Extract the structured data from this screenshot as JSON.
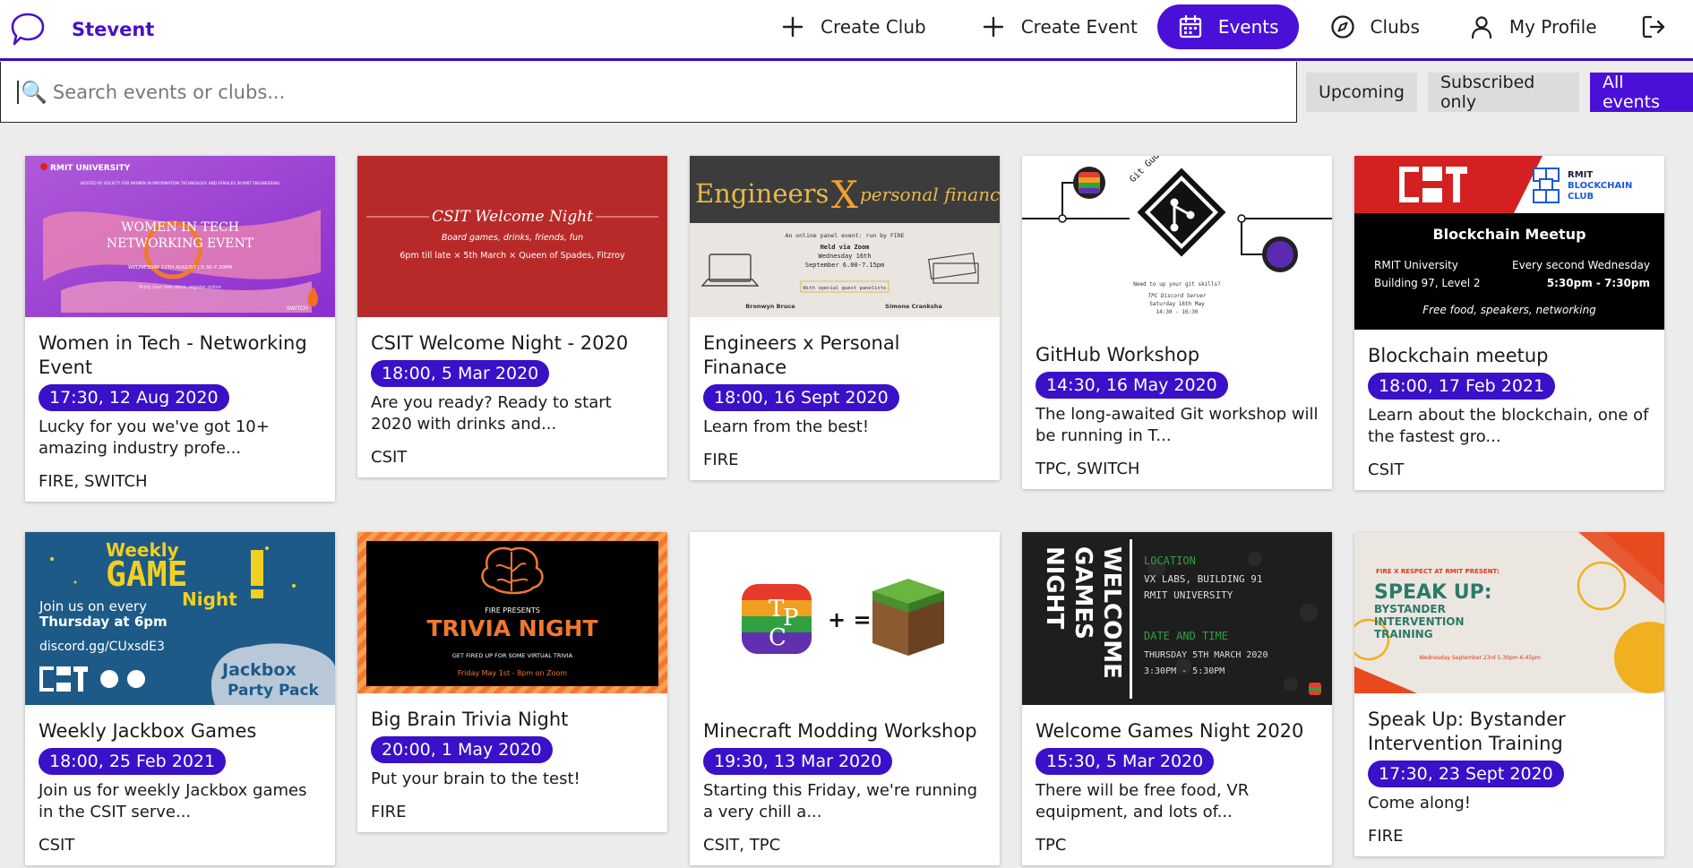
{
  "app": {
    "name": "Stevent"
  },
  "nav": {
    "create_club": "Create Club",
    "create_event": "Create Event",
    "events": "Events",
    "clubs": "Clubs",
    "my_profile": "My Profile"
  },
  "search": {
    "placeholder": "Search events or clubs..."
  },
  "filters": {
    "upcoming": "Upcoming",
    "subscribed": "Subscribed only",
    "all": "All events"
  },
  "colors": {
    "accent": "#4a10d8",
    "brand": "#4a10c8"
  },
  "events": [
    {
      "title": "Women in Tech - Networking Event",
      "date": "17:30, 12 Aug 2020",
      "desc": "Lucky for you we've got 10+ amazing industry profe...",
      "clubs": "FIRE, SWITCH",
      "poster": {
        "org": "RMIT UNIVERSITY",
        "hosted": "HOSTED BY SOCIETY FOR WOMEN IN INFORMATION TECHNOLOGY AND FEMALES IN RMIT ENGINEERING",
        "line1": "WOMEN IN TECH",
        "line2": "NETWORKING EVENT",
        "when": "WEDNESDAY 12TH AUGUST | 5:30-7:30PM",
        "sub": "Bring your own drink, register online",
        "badge": "SWITCH"
      }
    },
    {
      "title": "CSIT Welcome Night - 2020",
      "date": "18:00, 5 Mar 2020",
      "desc": "Are you ready? Ready to start 2020 with drinks and...",
      "clubs": "CSIT",
      "poster": {
        "heading": "CSIT Welcome Night",
        "sub": "Board games, drinks, friends, fun",
        "details": "6pm till late  ×  5th March  ×  Queen of Spades, Fitzroy"
      }
    },
    {
      "title": "Engineers x Personal Finanace",
      "date": "18:00, 16 Sept 2020",
      "desc": "Learn from the best!",
      "clubs": "FIRE",
      "poster": {
        "left": "Engineers",
        "x": "X",
        "right": "personal finance",
        "intro": "An online panel event: run by FIRE",
        "held": "Held via Zoom",
        "day": "Wednesday 16th",
        "time": "September 6.00-7.15pm",
        "guest": "With special guest panelists",
        "p1": "Bronwyn Bruce",
        "p2": "Simone Cranksha"
      }
    },
    {
      "title": "GitHub Workshop",
      "date": "14:30, 16 May 2020",
      "desc": "The long-awaited Git workshop will be running in T...",
      "clubs": "TPC, SWITCH",
      "poster": {
        "gitgud": "Git Gud",
        "q": "Need to up your git skills?",
        "where": "TPC Discord Server",
        "when": "Saturday 16th May",
        "time": "14:30 - 16:30"
      }
    },
    {
      "title": "Blockchain meetup",
      "date": "18:00, 17 Feb 2021",
      "desc": "Learn about the blockchain, one of the fastest gro...",
      "clubs": "CSIT",
      "poster": {
        "club1": "RMIT",
        "club2": "BLOCKCHAIN",
        "club3": "CLUB",
        "heading": "Blockchain Meetup",
        "loc1": "RMIT University",
        "loc2": "Building 97, Level 2",
        "freq": "Every second Wednesday",
        "time": "5:30pm - 7:30pm",
        "food": "Free food, speakers, networking"
      }
    },
    {
      "title": "Weekly Jackbox Games",
      "date": "18:00, 25 Feb 2021",
      "desc": "Join us for weekly Jackbox games in the CSIT serve...",
      "clubs": "CSIT",
      "poster": {
        "weekly": "Weekly",
        "game": "GAME",
        "night": "Night",
        "join": "Join us on every",
        "thu": "Thursday at 6pm",
        "link": "discord.gg/CUxsdE3",
        "jack": "Jackbox",
        "party": "Party Pack"
      }
    },
    {
      "title": "Big Brain Trivia Night",
      "date": "20:00, 1 May 2020",
      "desc": "Put your brain to the test!",
      "clubs": "FIRE",
      "poster": {
        "presents": "FIRE PRESENTS",
        "heading": "TRIVIA NIGHT",
        "sub": "GET FIRED UP FOR SOME VIRTUAL TRIVIA",
        "when": "Friday May 1st - 8pm on Zoom"
      }
    },
    {
      "title": "Minecraft Modding Workshop",
      "date": "19:30, 13 Mar 2020",
      "desc": "Starting this Friday, we're running a very chill a...",
      "clubs": "CSIT, TPC",
      "poster": {
        "plus": "+ ="
      }
    },
    {
      "title": "Welcome Games Night 2020",
      "date": "15:30, 5 Mar 2020",
      "desc": "There will be free food, VR equipment, and lots of...",
      "clubs": "TPC",
      "poster": {
        "v1": "WELCOME",
        "v2": "GAMES",
        "v3": "NIGHT",
        "loc": "LOCATION",
        "l1": "VX LABS, BUILDING 91",
        "l2": "RMIT UNIVERSITY",
        "dt": "DATE AND TIME",
        "d1": "THURSDAY 5TH MARCH 2020",
        "d2": "3:30PM - 5:30PM"
      }
    },
    {
      "title": "Speak Up: Bystander Intervention Training",
      "date": "17:30, 23 Sept 2020",
      "desc": "Come along!",
      "clubs": "FIRE",
      "poster": {
        "presents": "FIRE X RESPECT AT RMIT PRESENT:",
        "heading": "SPEAK UP:",
        "l1": "BYSTANDER",
        "l2": "INTERVENTION",
        "l3": "TRAINING",
        "when": "Wednesday September 23rd 5.30pm-6.45pm"
      }
    }
  ]
}
